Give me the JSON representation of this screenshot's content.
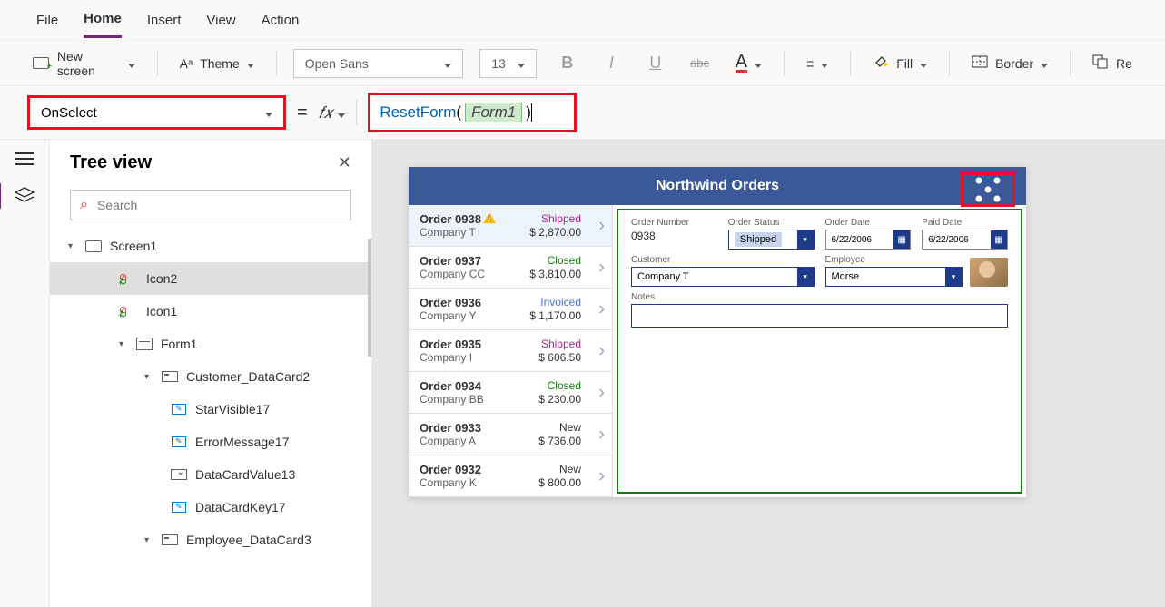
{
  "menubar": {
    "file": "File",
    "home": "Home",
    "insert": "Insert",
    "view": "View",
    "action": "Action"
  },
  "ribbon": {
    "new_screen": "New screen",
    "theme": "Theme",
    "font_family": "Open Sans",
    "font_size": "13",
    "fill": "Fill",
    "border": "Border",
    "reorder_prefix": "Re"
  },
  "formula": {
    "property": "OnSelect",
    "fn": "ResetForm",
    "arg": "Form1"
  },
  "tree": {
    "title": "Tree view",
    "search_placeholder": "Search",
    "nodes": {
      "screen1": "Screen1",
      "icon2": "Icon2",
      "icon1": "Icon1",
      "form1": "Form1",
      "customer_card": "Customer_DataCard2",
      "starvisible": "StarVisible17",
      "errormessage": "ErrorMessage17",
      "datacardvalue": "DataCardValue13",
      "datacardkey": "DataCardKey17",
      "employee_card": "Employee_DataCard3"
    }
  },
  "preview": {
    "title": "Northwind Orders",
    "list": [
      {
        "order": "Order 0938",
        "company": "Company T",
        "status": "Shipped",
        "statusClass": "st-shipped",
        "amount": "$ 2,870.00",
        "warn": true,
        "sel": true
      },
      {
        "order": "Order 0937",
        "company": "Company CC",
        "status": "Closed",
        "statusClass": "st-closed",
        "amount": "$ 3,810.00",
        "warn": false,
        "sel": false
      },
      {
        "order": "Order 0936",
        "company": "Company Y",
        "status": "Invoiced",
        "statusClass": "st-invoiced",
        "amount": "$ 1,170.00",
        "warn": false,
        "sel": false
      },
      {
        "order": "Order 0935",
        "company": "Company I",
        "status": "Shipped",
        "statusClass": "st-shipped",
        "amount": "$ 606.50",
        "warn": false,
        "sel": false
      },
      {
        "order": "Order 0934",
        "company": "Company BB",
        "status": "Closed",
        "statusClass": "st-closed",
        "amount": "$ 230.00",
        "warn": false,
        "sel": false
      },
      {
        "order": "Order 0933",
        "company": "Company A",
        "status": "New",
        "statusClass": "st-new",
        "amount": "$ 736.00",
        "warn": false,
        "sel": false
      },
      {
        "order": "Order 0932",
        "company": "Company K",
        "status": "New",
        "statusClass": "st-new",
        "amount": "$ 800.00",
        "warn": false,
        "sel": false
      }
    ],
    "form": {
      "order_number_label": "Order Number",
      "order_number": "0938",
      "order_status_label": "Order Status",
      "order_status": "Shipped",
      "order_date_label": "Order Date",
      "order_date": "6/22/2006",
      "paid_date_label": "Paid Date",
      "paid_date": "6/22/2006",
      "customer_label": "Customer",
      "customer": "Company T",
      "employee_label": "Employee",
      "employee": "Morse",
      "notes_label": "Notes"
    }
  }
}
